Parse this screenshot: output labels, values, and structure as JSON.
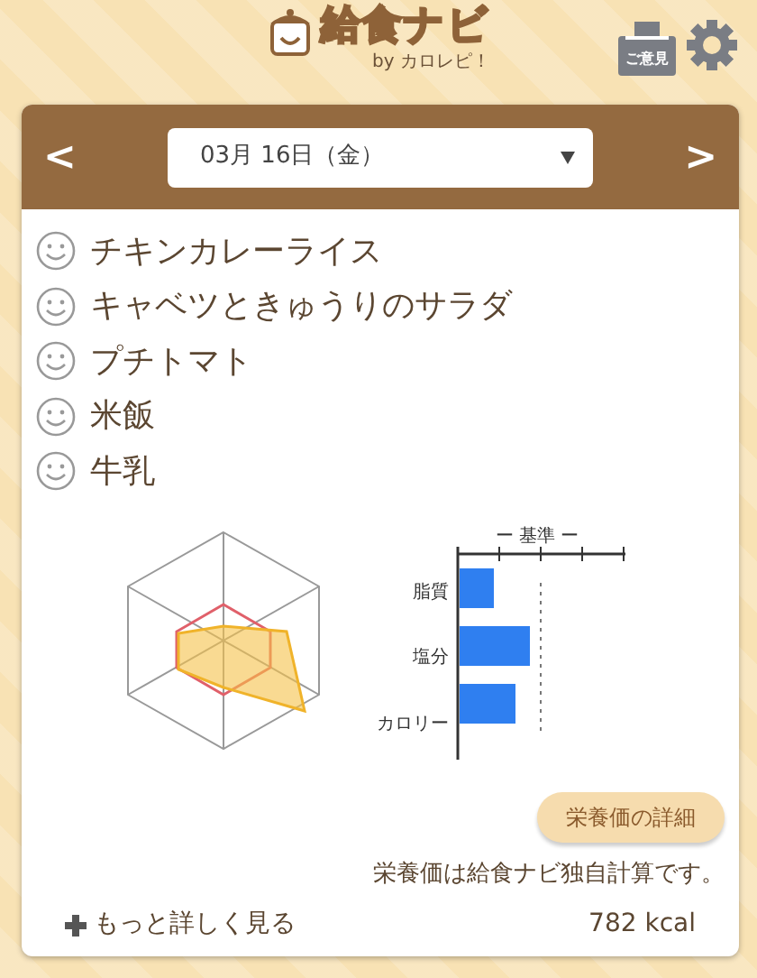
{
  "header": {
    "logo_title": "給食ナビ",
    "logo_subtitle": "by カロレピ！",
    "feedback_label": "ご意見"
  },
  "date_select": {
    "value": "03月 16日（金）",
    "prev": "<",
    "next": ">"
  },
  "menu": [
    {
      "name": "チキンカレーライス"
    },
    {
      "name": "キャベツときゅうりのサラダ"
    },
    {
      "name": "プチトマト"
    },
    {
      "name": "米飯"
    },
    {
      "name": "牛乳"
    }
  ],
  "bar_chart": {
    "title": "ー 基準 ー",
    "labels": [
      "脂質",
      "塩分",
      "カロリー"
    ]
  },
  "detail_button": "栄養価の詳細",
  "note": "栄養価は給食ナビ独自計算です。",
  "more_link": "もっと詳しく見る",
  "calories": "782 kcal"
}
